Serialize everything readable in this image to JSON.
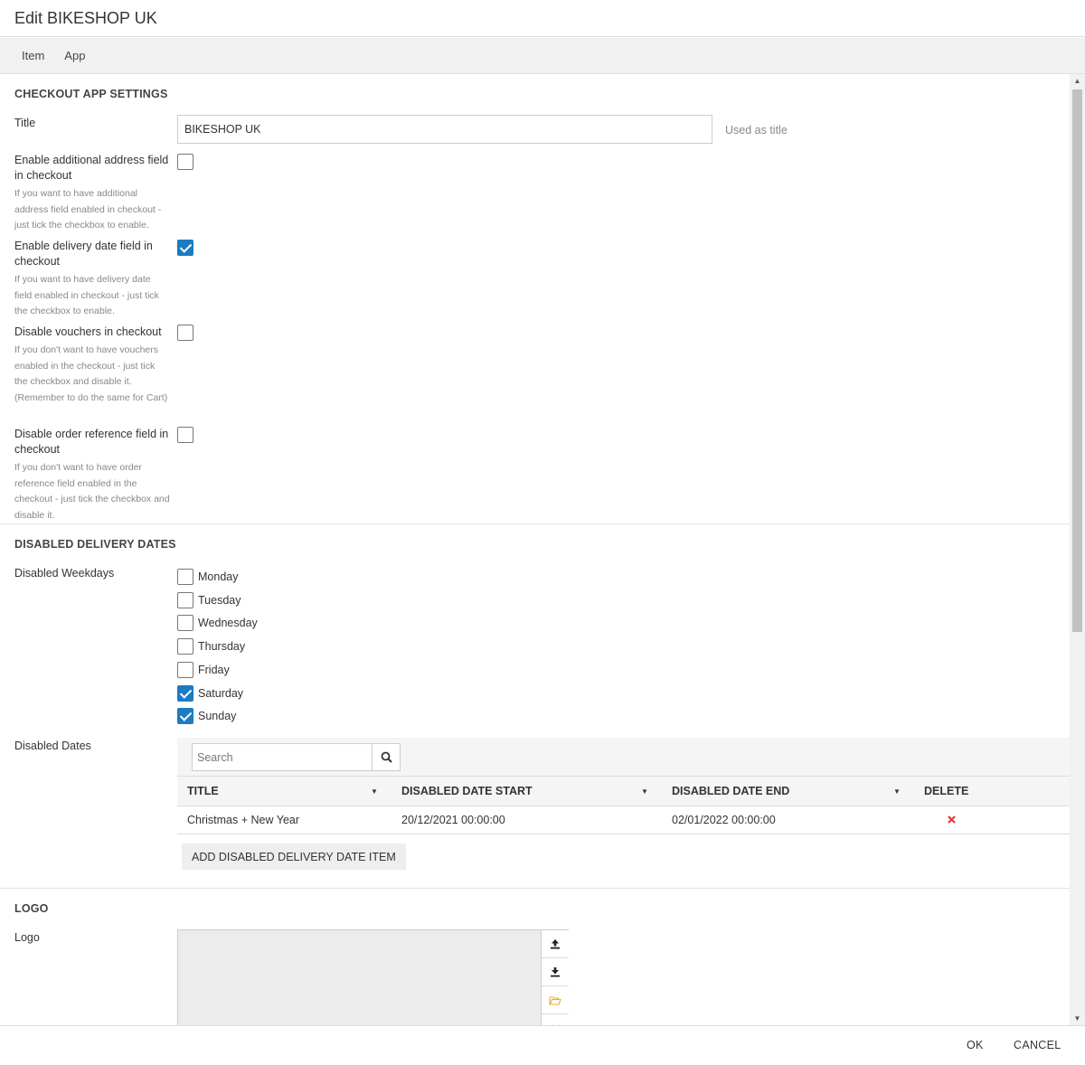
{
  "dialog": {
    "title": "Edit BIKESHOP UK"
  },
  "tabs": [
    {
      "label": "Item"
    },
    {
      "label": "App"
    }
  ],
  "checkout_settings": {
    "section_title": "CHECKOUT APP SETTINGS",
    "title_label": "Title",
    "title_value": "BIKESHOP UK",
    "title_note": "Used as title",
    "fields": [
      {
        "label": "Enable additional address field in checkout",
        "help": "If you want to have additional address field enabled in checkout - just tick the checkbox to enable.",
        "checked": false
      },
      {
        "label": "Enable delivery date field in checkout",
        "help": "If you want to have delivery date field enabled in checkout - just tick the checkbox to enable.",
        "checked": true
      },
      {
        "label": "Disable vouchers in checkout",
        "help": "If you don't want to have vouchers enabled in the checkout - just tick the checkbox and disable it. (Remember to do the same for Cart)",
        "checked": false
      },
      {
        "label": "Disable order reference field in checkout",
        "help": "If you don't want to have order reference field enabled in the checkout - just tick the checkbox and disable it.",
        "checked": false
      }
    ]
  },
  "delivery_dates": {
    "section_title": "DISABLED DELIVERY DATES",
    "weekdays_label": "Disabled Weekdays",
    "weekdays": [
      {
        "label": "Monday",
        "checked": false
      },
      {
        "label": "Tuesday",
        "checked": false
      },
      {
        "label": "Wednesday",
        "checked": false
      },
      {
        "label": "Thursday",
        "checked": false
      },
      {
        "label": "Friday",
        "checked": false
      },
      {
        "label": "Saturday",
        "checked": true
      },
      {
        "label": "Sunday",
        "checked": true
      }
    ],
    "dates_label": "Disabled Dates",
    "search_placeholder": "Search",
    "columns": [
      "TITLE",
      "DISABLED DATE START",
      "DISABLED DATE END",
      "DELETE"
    ],
    "rows": [
      {
        "title": "Christmas + New Year",
        "start": "20/12/2021 00:00:00",
        "end": "02/01/2022 00:00:00"
      }
    ],
    "add_button": "ADD DISABLED DELIVERY DATE ITEM"
  },
  "logo": {
    "section_title": "LOGO",
    "label": "Logo"
  },
  "footer": {
    "ok": "OK",
    "cancel": "CANCEL"
  },
  "colors": {
    "checkbox_checked": "#1b7bc3",
    "delete_icon": "#e53935",
    "folder_icon": "#f0a830"
  }
}
